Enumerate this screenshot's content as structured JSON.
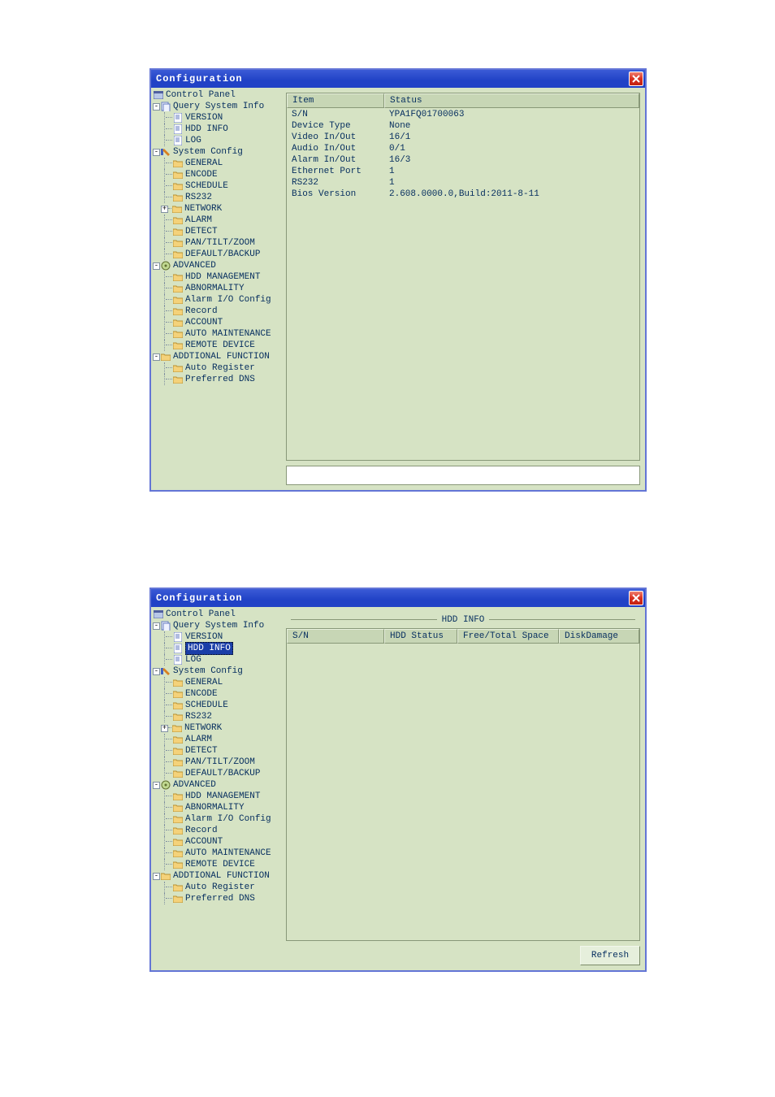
{
  "window_title": "Configuration",
  "tree": {
    "root": "Control Panel",
    "qsi": {
      "label": "Query System Info",
      "children": [
        "VERSION",
        "HDD INFO",
        "LOG"
      ]
    },
    "syscfg": {
      "label": "System Config",
      "children": [
        "GENERAL",
        "ENCODE",
        "SCHEDULE",
        "RS232",
        "NETWORK",
        "ALARM",
        "DETECT",
        "PAN/TILT/ZOOM",
        "DEFAULT/BACKUP"
      ]
    },
    "adv": {
      "label": "ADVANCED",
      "children": [
        "HDD MANAGEMENT",
        "ABNORMALITY",
        "Alarm I/O Config",
        "Record",
        "ACCOUNT",
        "AUTO MAINTENANCE",
        "REMOTE DEVICE"
      ]
    },
    "addf": {
      "label": "ADDTIONAL FUNCTION",
      "children": [
        "Auto Register",
        "Preferred DNS"
      ]
    }
  },
  "version_table": {
    "headers": {
      "item": "Item",
      "status": "Status"
    },
    "rows": [
      {
        "item": "S/N",
        "status": "YPA1FQ01700063"
      },
      {
        "item": "Device Type",
        "status": "None"
      },
      {
        "item": "Video In/Out",
        "status": "16/1"
      },
      {
        "item": "Audio In/Out",
        "status": "0/1"
      },
      {
        "item": "Alarm In/Out",
        "status": "16/3"
      },
      {
        "item": "Ethernet Port",
        "status": "1"
      },
      {
        "item": "RS232",
        "status": "1"
      },
      {
        "item": "Bios Version",
        "status": "2.608.0000.0,Build:2011-8-11"
      }
    ]
  },
  "hdd_section": {
    "title": "HDD INFO",
    "headers": {
      "sn": "S/N",
      "status": "HDD Status",
      "space": "Free/Total Space",
      "damage": "DiskDamage"
    }
  },
  "refresh_label": "Refresh"
}
